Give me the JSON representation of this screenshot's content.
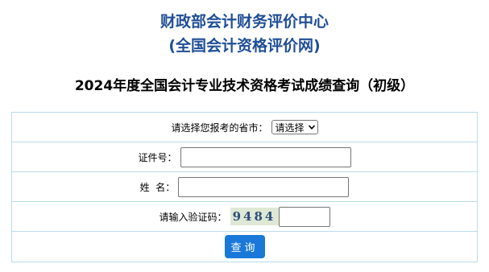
{
  "header": {
    "org_line1": "财政部会计财务评价中心",
    "org_line2": "(全国会计资格评价网)",
    "exam_title": "2024年度全国会计专业技术资格考试成绩查询（初级）",
    "org_color": "#1f4e96"
  },
  "form": {
    "province_label": "请选择您报考的省市：",
    "province_selected": "请选择",
    "id_label": "证件号：",
    "id_value": "",
    "name_label": "姓  名：",
    "name_value": "",
    "captcha_label": "请输入验证码：",
    "captcha_image_text": "9484",
    "captcha_value": "",
    "submit_label": "查询",
    "border_color": "#b9dcec",
    "button_color": "#1a79d8",
    "icons": {
      "select_arrow": "chevron-down-icon"
    }
  }
}
